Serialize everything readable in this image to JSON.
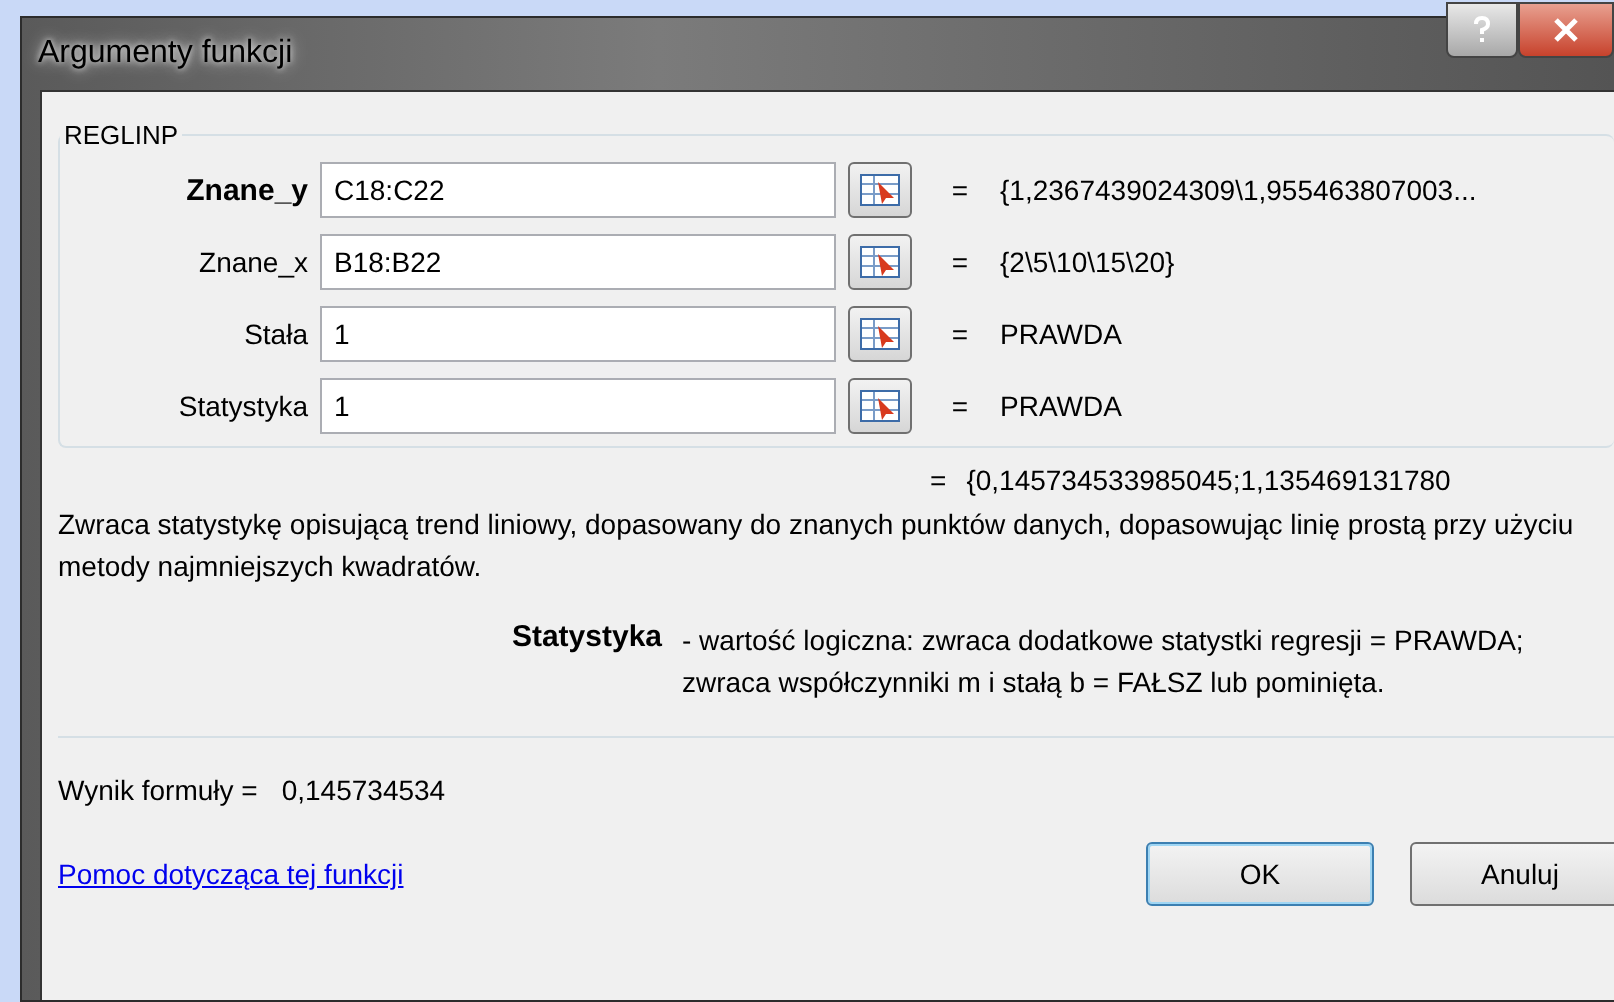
{
  "window": {
    "title": "Argumenty funkcji"
  },
  "function_name": "REGLINP",
  "arguments": [
    {
      "label": "Znane_y",
      "value": "C18:C22",
      "equals": "=",
      "result": "{1,2367439024309\\1,955463807003...",
      "selected": true
    },
    {
      "label": "Znane_x",
      "value": "B18:B22",
      "equals": "=",
      "result": "{2\\5\\10\\15\\20}",
      "selected": false
    },
    {
      "label": "Stała",
      "value": "1",
      "equals": "=",
      "result": "PRAWDA",
      "selected": false
    },
    {
      "label": "Statystyka",
      "value": "1",
      "equals": "=",
      "result": "PRAWDA",
      "selected": false
    }
  ],
  "function_result": {
    "equals": "=",
    "value": "{0,145734533985045;1,135469131780"
  },
  "description": "Zwraca statystykę opisującą trend liniowy, dopasowany do znanych punktów danych, dopasowując linię prostą przy użyciu metody najmniejszych kwadratów.",
  "argument_help": {
    "name": "Statystyka",
    "text": "- wartość logiczna: zwraca dodatkowe statystki regresji = PRAWDA; zwraca współczynniki m i stałą b = FAŁSZ lub pominięta."
  },
  "formula_result": {
    "label": "Wynik formuły =",
    "value": "0,145734534"
  },
  "help_link": "Pomoc dotycząca tej funkcji",
  "buttons": [
    {
      "label": "OK",
      "default": true
    },
    {
      "label": "Anuluj",
      "default": false
    }
  ]
}
